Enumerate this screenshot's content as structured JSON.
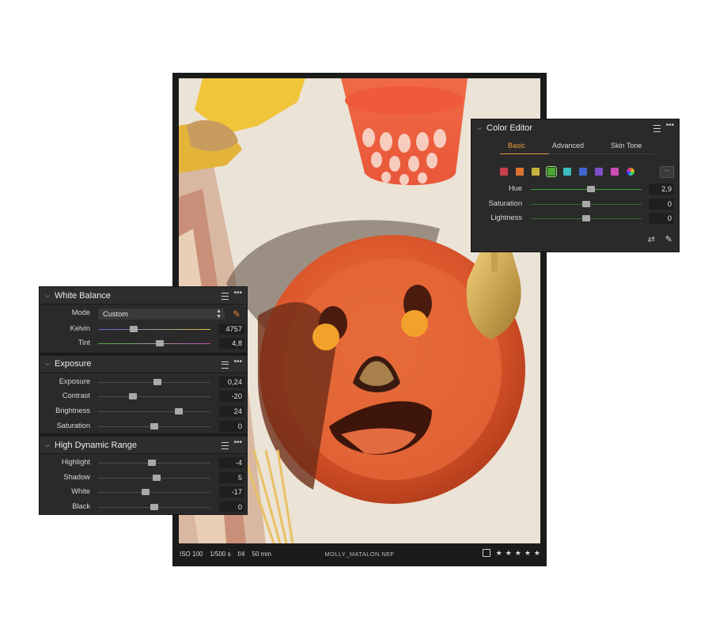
{
  "photo": {
    "meta": [
      "ISO 100",
      "1/500 s",
      "f/4",
      "50 mm"
    ],
    "filename": "MOLLY_MATALON.NEF",
    "stars": 5
  },
  "color_editor": {
    "title": "Color Editor",
    "tabs": [
      "Basic",
      "Advanced",
      "Skin Tone"
    ],
    "active_tab": "Basic",
    "more_label": "...",
    "swatch_colors": [
      "#c9404b",
      "#dd7430",
      "#c8b23b",
      "#49a833",
      "#3cbdbf",
      "#3f66cf",
      "#7e4fc9",
      "#c94cb3",
      "#d0d0d0"
    ],
    "selected_swatch": 3,
    "sliders": [
      {
        "label": "Hue",
        "value": "2,9",
        "position": 0.54
      },
      {
        "label": "Saturation",
        "value": "0",
        "position": 0.5
      },
      {
        "label": "Lightness",
        "value": "0",
        "position": 0.5
      }
    ]
  },
  "white_balance": {
    "title": "White Balance",
    "mode_label": "Mode",
    "mode_value": "Custom",
    "sliders": [
      {
        "label": "Kelvin",
        "value": "4757",
        "position": 0.32
      },
      {
        "label": "Tint",
        "value": "4,8",
        "position": 0.55
      }
    ]
  },
  "exposure": {
    "title": "Exposure",
    "sliders": [
      {
        "label": "Exposure",
        "value": "0,24",
        "position": 0.53
      },
      {
        "label": "Contrast",
        "value": "-20",
        "position": 0.31
      },
      {
        "label": "Brightness",
        "value": "24",
        "position": 0.72
      },
      {
        "label": "Saturation",
        "value": "0",
        "position": 0.5
      }
    ]
  },
  "hdr": {
    "title": "High Dynamic Range",
    "sliders": [
      {
        "label": "Highlight",
        "value": "-4",
        "position": 0.48
      },
      {
        "label": "Shadow",
        "value": "5",
        "position": 0.52
      },
      {
        "label": "White",
        "value": "-17",
        "position": 0.42
      },
      {
        "label": "Black",
        "value": "0",
        "position": 0.5
      }
    ]
  }
}
